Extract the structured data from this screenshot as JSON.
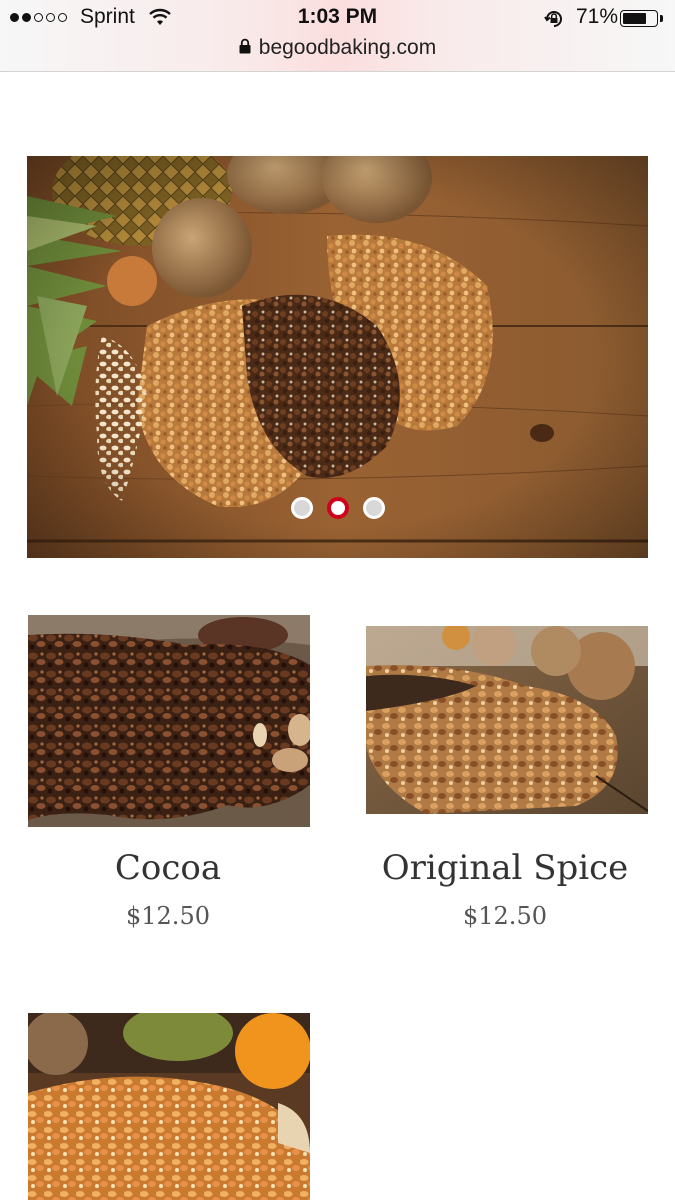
{
  "status_bar": {
    "carrier": "Sprint",
    "time": "1:03 PM",
    "battery_percent": "71%",
    "battery_level": 0.71,
    "url": "begoodbaking.com"
  },
  "hero": {
    "slide_count": 3,
    "active_slide": 2
  },
  "products": [
    {
      "name": "Cocoa",
      "price": "$12.50"
    },
    {
      "name": "Original Spice",
      "price": "$12.50"
    },
    {
      "name": "",
      "price": ""
    }
  ],
  "colors": {
    "accent": "#d0021b",
    "wood": "#8a5a2f",
    "text": "#333333"
  }
}
